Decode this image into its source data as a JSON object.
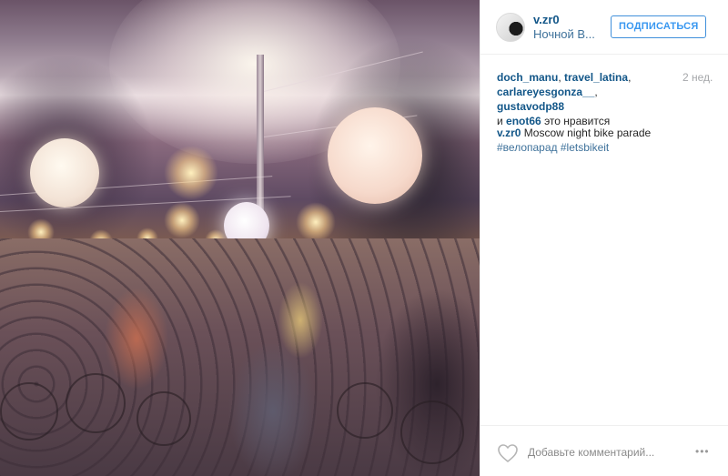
{
  "post": {
    "image_description_icon": "photo",
    "header": {
      "username": "v.zr0",
      "location": "Ночной В...",
      "follow_label": "ПОДПИСАТЬСЯ"
    },
    "likes": {
      "users": [
        "doch_manu",
        "travel_latina",
        "carlareyesgonza__",
        "gustavodp88",
        "enot66"
      ],
      "sep1": ", ",
      "sep2": ",",
      "sep3": ", ",
      "conjunction": "и ",
      "suffix": " это нравится"
    },
    "time_ago": "2 нед.",
    "caption": {
      "author": "v.zr0",
      "text": " Moscow night bike parade",
      "hashtags": [
        "#велопарад",
        "#letsbikeit"
      ]
    },
    "footer": {
      "like_icon": "heart-outline-icon",
      "comment_placeholder": "Добавьте комментарий...",
      "more_label": "•••"
    },
    "colors": {
      "link_dark": "#125688",
      "link_light": "#3f729b",
      "follow_blue": "#3897f0",
      "muted": "#a5a7aa"
    }
  }
}
